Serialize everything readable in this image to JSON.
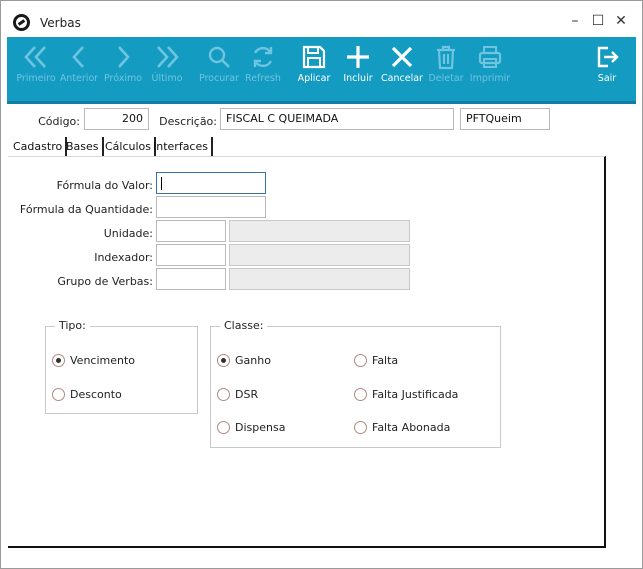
{
  "window": {
    "title": "Verbas",
    "minimize": "–",
    "maximize": "☐",
    "close": "✕"
  },
  "toolbar": {
    "primeiro": "Primeiro",
    "anterior": "Anterior",
    "proximo": "Próximo",
    "ultimo": "Último",
    "procurar": "Procurar",
    "refresh": "Refresh",
    "aplicar": "Aplicar",
    "incluir": "Incluir",
    "cancelar": "Cancelar",
    "deletar": "Deletar",
    "imprimir": "Imprimir",
    "sair": "Sair"
  },
  "header": {
    "codigo_label": "Código:",
    "codigo_value": "200",
    "descricao_label": "Descrição:",
    "descricao_value": "FISCAL C QUEIMADA",
    "short_value": "PFTQueim"
  },
  "tabs": [
    "Cadastro",
    "Bases",
    "Cálculos",
    "Interfaces"
  ],
  "form": {
    "formula_valor_label": "Fórmula do Valor:",
    "formula_valor_value": "",
    "formula_qtd_label": "Fórmula da Quantidade:",
    "formula_qtd_value": "",
    "unidade_label": "Unidade:",
    "indexador_label": "Indexador:",
    "grupo_label": "Grupo de Verbas:"
  },
  "tipo": {
    "title": "Tipo:",
    "options": [
      "Vencimento",
      "Desconto"
    ],
    "selected": "Vencimento"
  },
  "classe": {
    "title": "Classe:",
    "options": [
      "Ganho",
      "DSR",
      "Dispensa",
      "Falta",
      "Falta Justificada",
      "Falta Abonada"
    ],
    "selected": "Ganho"
  },
  "colors": {
    "toolbar": "#149bc2",
    "disabled_label": "#6fc4e0",
    "enabled_label": "#ffffff"
  }
}
